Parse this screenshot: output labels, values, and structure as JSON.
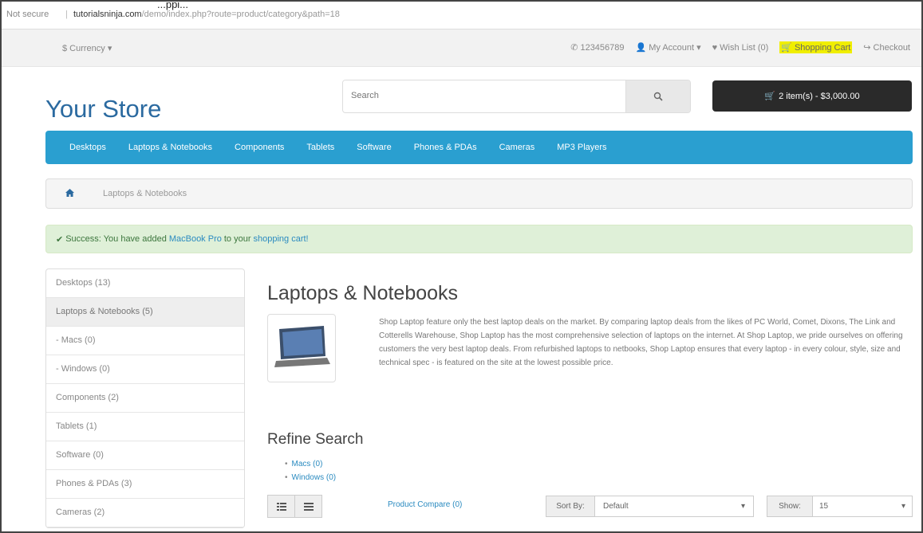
{
  "browser": {
    "security_label": "Not secure",
    "separator": "|",
    "url_domain": "tutorialsninja.com",
    "url_path": "/demo/index.php?route=product/category&path=18",
    "tab_title_fragment": "...ppi..."
  },
  "topnav": {
    "currency": "$ Currency",
    "phone": "123456789",
    "account": "My Account",
    "wishlist": "Wish List (0)",
    "shopping_cart": "Shopping Cart",
    "checkout": "Checkout"
  },
  "header": {
    "logo": "Your Store",
    "search_placeholder": "Search",
    "cart_button": "2 item(s) - $3,000.00"
  },
  "menu": {
    "items": [
      "Desktops",
      "Laptops & Notebooks",
      "Components",
      "Tablets",
      "Software",
      "Phones & PDAs",
      "Cameras",
      "MP3 Players"
    ]
  },
  "breadcrumb": {
    "current": "Laptops & Notebooks"
  },
  "alert": {
    "prefix": "Success: You have added",
    "product": "MacBook Pro",
    "middle": "to your",
    "link": "shopping cart!"
  },
  "sidebar": {
    "items": [
      "Desktops (13)",
      "Laptops & Notebooks (5)",
      "- Macs (0)",
      "- Windows (0)",
      "Components (2)",
      "Tablets (1)",
      "Software (0)",
      "Phones & PDAs (3)",
      "Cameras (2)"
    ],
    "active_index": 1
  },
  "content": {
    "heading": "Laptops & Notebooks",
    "description": "Shop Laptop feature only the best laptop deals on the market. By comparing laptop deals from the likes of PC World, Comet, Dixons, The Link and Cotterells Warehouse, Shop Laptop has the most comprehensive selection of laptops on the internet. At Shop Laptop, we pride ourselves on offering customers the very best laptop deals. From refurbished laptops to netbooks, Shop Laptop ensures that every laptop - in every colour, style, size and technical spec - is featured on the site at the lowest possible price.",
    "refine_heading": "Refine Search",
    "refine_items": [
      "Macs (0)",
      "Windows (0)"
    ],
    "product_compare": "Product Compare (0)",
    "sort_label": "Sort By:",
    "sort_value": "Default",
    "show_label": "Show:",
    "show_value": "15"
  },
  "colors": {
    "menu_bg": "#2a9fd0",
    "logo": "#2b6aa0",
    "cart_bg": "#2a2a2a",
    "alert_bg": "#dff0d8",
    "highlight": "#f0ee00"
  }
}
